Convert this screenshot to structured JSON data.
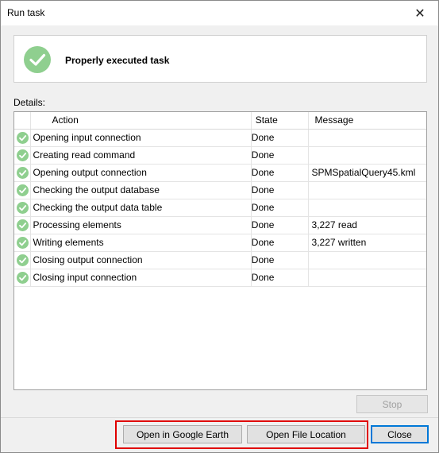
{
  "window": {
    "title": "Run task",
    "close_glyph": "✕"
  },
  "header": {
    "status_text": "Properly executed task",
    "status_icon": "check-circle-icon"
  },
  "details": {
    "label": "Details:",
    "columns": {
      "action": "Action",
      "state": "State",
      "message": "Message"
    },
    "rows": [
      {
        "action": "Opening input connection",
        "state": "Done",
        "message": ""
      },
      {
        "action": "Creating read command",
        "state": "Done",
        "message": ""
      },
      {
        "action": "Opening output connection",
        "state": "Done",
        "message": "SPMSpatialQuery45.kml"
      },
      {
        "action": "Checking the output database",
        "state": "Done",
        "message": ""
      },
      {
        "action": "Checking the output data table",
        "state": "Done",
        "message": ""
      },
      {
        "action": "Processing elements",
        "state": "Done",
        "message": "3,227 read"
      },
      {
        "action": "Writing elements",
        "state": "Done",
        "message": "3,227 written"
      },
      {
        "action": "Closing output connection",
        "state": "Done",
        "message": ""
      },
      {
        "action": "Closing input connection",
        "state": "Done",
        "message": ""
      }
    ]
  },
  "buttons": {
    "stop": "Stop",
    "google_earth": "Open in Google Earth",
    "file_location": "Open File Location",
    "close": "Close"
  },
  "colors": {
    "success_green": "#8fcf8f",
    "highlight_red": "#e00000",
    "focus_blue": "#0078d7"
  }
}
